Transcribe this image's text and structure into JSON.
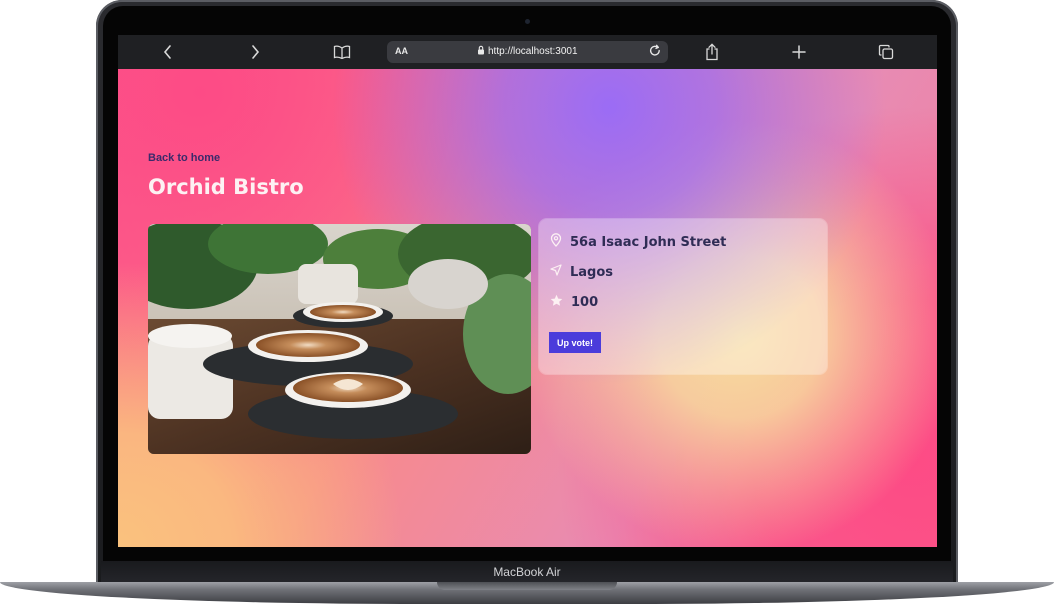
{
  "device": {
    "brand_label": "MacBook Air"
  },
  "browser": {
    "text_size_label": "AA",
    "url": "http://localhost:3001",
    "icons": {
      "back": "chevron-left-icon",
      "forward": "chevron-right-icon",
      "bookmarks": "book-icon",
      "lock": "lock-icon",
      "reload": "reload-icon",
      "share": "share-icon",
      "new_tab": "plus-icon",
      "tabs": "tabs-icon"
    }
  },
  "page": {
    "back_link": "Back to home",
    "title": "Orchid Bistro",
    "image_alt": "coffee cups with latte art among plants",
    "details": {
      "address": "56a Isaac John Street",
      "city": "Lagos",
      "votes": "100",
      "upvote_label": "Up vote!"
    }
  },
  "colors": {
    "accent_button": "#4b3cdb",
    "title_text": "#fdf1f3",
    "card_text": "#2f2c55"
  }
}
